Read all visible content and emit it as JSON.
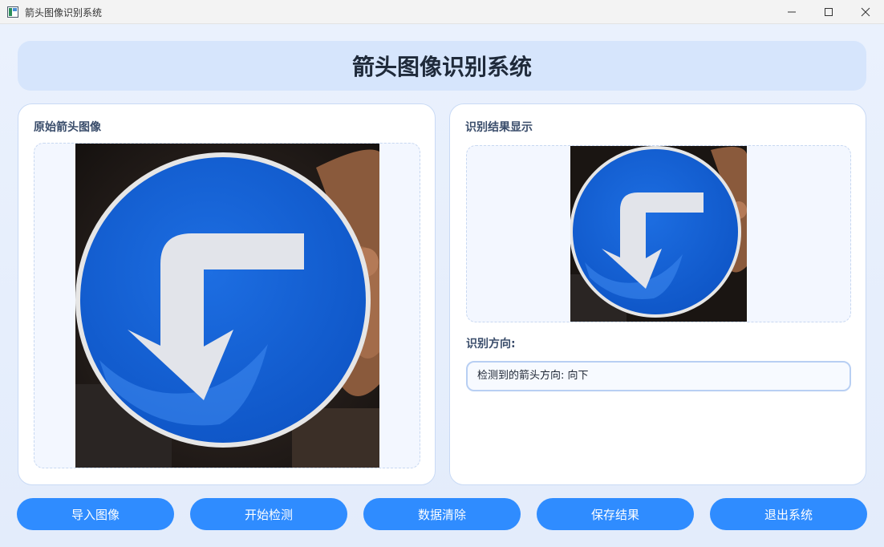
{
  "window": {
    "title": "箭头图像识别系统",
    "icons": [
      "app-icon",
      "minimize-icon",
      "maximize-icon",
      "close-icon"
    ]
  },
  "header": {
    "title": "箭头图像识别系统"
  },
  "left_panel": {
    "title": "原始箭头图像",
    "image": "blue-circular-sign-bent-arrow-pointing-down-held-in-hand"
  },
  "right_panel": {
    "title": "识别结果显示",
    "image": "blue-circular-sign-bent-arrow-pointing-down-held-in-hand",
    "direction_label": "识别方向:",
    "direction_value": "检测到的箭头方向: 向下"
  },
  "buttons": {
    "import": "导入图像",
    "detect": "开始检测",
    "clear": "数据清除",
    "save": "保存结果",
    "exit": "退出系统"
  },
  "colors": {
    "accent": "#2f8cff",
    "header_bg": "#d6e5fc",
    "sign_blue": "#1560d6"
  }
}
